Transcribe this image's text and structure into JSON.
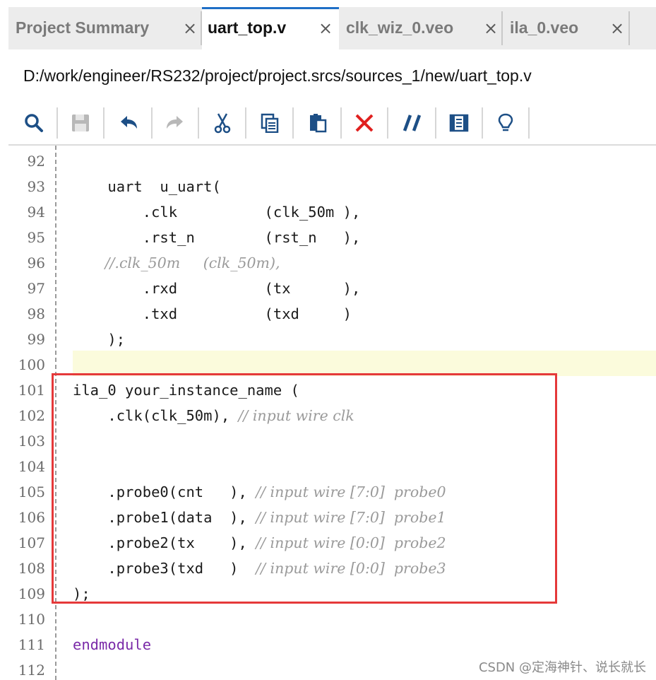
{
  "tabs": [
    {
      "label": "Project Summary",
      "active": false
    },
    {
      "label": "uart_top.v",
      "active": true
    },
    {
      "label": "clk_wiz_0.veo",
      "active": false
    },
    {
      "label": "ila_0.veo",
      "active": false
    }
  ],
  "close_glyph": "×",
  "file_path": "D:/work/engineer/RS232/project/project.srcs/sources_1/new/uart_top.v",
  "toolbar": [
    {
      "icon": "search-icon"
    },
    {
      "icon": "save-icon",
      "disabled": true
    },
    {
      "icon": "undo-icon"
    },
    {
      "icon": "redo-icon",
      "disabled": true
    },
    {
      "icon": "cut-icon"
    },
    {
      "icon": "copy-icon"
    },
    {
      "icon": "paste-icon"
    },
    {
      "icon": "delete-icon"
    },
    {
      "icon": "comment-toggle-icon"
    },
    {
      "icon": "insert-template-icon"
    },
    {
      "icon": "lightbulb-icon"
    }
  ],
  "colors": {
    "active_tab_accent": "#1f6fc6",
    "highlight_box": "#e5393a",
    "current_line": "#fbfbdc",
    "keyword": "#7a2aa8",
    "comment": "#9a9a9a",
    "delete_icon": "#e0201f",
    "icon_blue": "#1d4f86"
  },
  "editor": {
    "current_line_number": "100",
    "lines": [
      {
        "num": "92",
        "segments": []
      },
      {
        "num": "93",
        "segments": [
          {
            "t": "    uart  u_uart(",
            "c": "code"
          }
        ]
      },
      {
        "num": "94",
        "segments": [
          {
            "t": "        .clk          (clk_50m ),",
            "c": "code"
          }
        ]
      },
      {
        "num": "95",
        "segments": [
          {
            "t": "        .rst_n        (rst_n   ),",
            "c": "code"
          }
        ]
      },
      {
        "num": "96",
        "segments": [
          {
            "t": "       //.clk_50m     (clk_50m),",
            "c": "comment"
          }
        ]
      },
      {
        "num": "97",
        "segments": [
          {
            "t": "        .rxd          (tx      ),",
            "c": "code"
          }
        ]
      },
      {
        "num": "98",
        "segments": [
          {
            "t": "        .txd          (txd     )",
            "c": "code"
          }
        ]
      },
      {
        "num": "99",
        "segments": [
          {
            "t": "    );",
            "c": "code"
          }
        ]
      },
      {
        "num": "100",
        "segments": []
      },
      {
        "num": "101",
        "segments": [
          {
            "t": "ila_0 your_instance_name (",
            "c": "code"
          }
        ]
      },
      {
        "num": "102",
        "segments": [
          {
            "t": "    .clk(clk_50m), ",
            "c": "code"
          },
          {
            "t": "// input wire clk",
            "c": "comment"
          }
        ]
      },
      {
        "num": "103",
        "segments": []
      },
      {
        "num": "104",
        "segments": []
      },
      {
        "num": "105",
        "segments": [
          {
            "t": "    .probe0(cnt   ), ",
            "c": "code"
          },
          {
            "t": "// input wire [7:0]  probe0",
            "c": "comment"
          }
        ]
      },
      {
        "num": "106",
        "segments": [
          {
            "t": "    .probe1(data  ), ",
            "c": "code"
          },
          {
            "t": "// input wire [7:0]  probe1",
            "c": "comment"
          }
        ]
      },
      {
        "num": "107",
        "segments": [
          {
            "t": "    .probe2(tx    ), ",
            "c": "code"
          },
          {
            "t": "// input wire [0:0]  probe2",
            "c": "comment"
          }
        ]
      },
      {
        "num": "108",
        "segments": [
          {
            "t": "    .probe3(txd   )  ",
            "c": "code"
          },
          {
            "t": "// input wire [0:0]  probe3",
            "c": "comment"
          }
        ]
      },
      {
        "num": "109",
        "segments": [
          {
            "t": ");",
            "c": "code"
          }
        ]
      },
      {
        "num": "110",
        "segments": []
      },
      {
        "num": "111",
        "segments": [
          {
            "t": "endmodule",
            "c": "keyword"
          }
        ]
      },
      {
        "num": "112",
        "segments": []
      }
    ]
  },
  "watermark": "CSDN @定海神针、说长就长"
}
